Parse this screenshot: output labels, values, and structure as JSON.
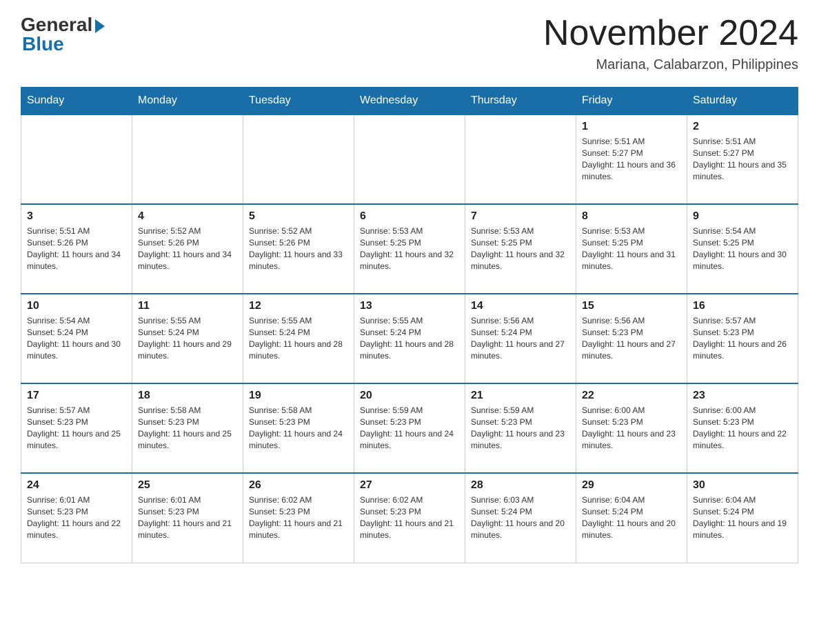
{
  "logo": {
    "general": "General",
    "blue": "Blue"
  },
  "title": "November 2024",
  "location": "Mariana, Calabarzon, Philippines",
  "days_of_week": [
    "Sunday",
    "Monday",
    "Tuesday",
    "Wednesday",
    "Thursday",
    "Friday",
    "Saturday"
  ],
  "weeks": [
    [
      {
        "day": "",
        "sunrise": "",
        "sunset": "",
        "daylight": ""
      },
      {
        "day": "",
        "sunrise": "",
        "sunset": "",
        "daylight": ""
      },
      {
        "day": "",
        "sunrise": "",
        "sunset": "",
        "daylight": ""
      },
      {
        "day": "",
        "sunrise": "",
        "sunset": "",
        "daylight": ""
      },
      {
        "day": "",
        "sunrise": "",
        "sunset": "",
        "daylight": ""
      },
      {
        "day": "1",
        "sunrise": "Sunrise: 5:51 AM",
        "sunset": "Sunset: 5:27 PM",
        "daylight": "Daylight: 11 hours and 36 minutes."
      },
      {
        "day": "2",
        "sunrise": "Sunrise: 5:51 AM",
        "sunset": "Sunset: 5:27 PM",
        "daylight": "Daylight: 11 hours and 35 minutes."
      }
    ],
    [
      {
        "day": "3",
        "sunrise": "Sunrise: 5:51 AM",
        "sunset": "Sunset: 5:26 PM",
        "daylight": "Daylight: 11 hours and 34 minutes."
      },
      {
        "day": "4",
        "sunrise": "Sunrise: 5:52 AM",
        "sunset": "Sunset: 5:26 PM",
        "daylight": "Daylight: 11 hours and 34 minutes."
      },
      {
        "day": "5",
        "sunrise": "Sunrise: 5:52 AM",
        "sunset": "Sunset: 5:26 PM",
        "daylight": "Daylight: 11 hours and 33 minutes."
      },
      {
        "day": "6",
        "sunrise": "Sunrise: 5:53 AM",
        "sunset": "Sunset: 5:25 PM",
        "daylight": "Daylight: 11 hours and 32 minutes."
      },
      {
        "day": "7",
        "sunrise": "Sunrise: 5:53 AM",
        "sunset": "Sunset: 5:25 PM",
        "daylight": "Daylight: 11 hours and 32 minutes."
      },
      {
        "day": "8",
        "sunrise": "Sunrise: 5:53 AM",
        "sunset": "Sunset: 5:25 PM",
        "daylight": "Daylight: 11 hours and 31 minutes."
      },
      {
        "day": "9",
        "sunrise": "Sunrise: 5:54 AM",
        "sunset": "Sunset: 5:25 PM",
        "daylight": "Daylight: 11 hours and 30 minutes."
      }
    ],
    [
      {
        "day": "10",
        "sunrise": "Sunrise: 5:54 AM",
        "sunset": "Sunset: 5:24 PM",
        "daylight": "Daylight: 11 hours and 30 minutes."
      },
      {
        "day": "11",
        "sunrise": "Sunrise: 5:55 AM",
        "sunset": "Sunset: 5:24 PM",
        "daylight": "Daylight: 11 hours and 29 minutes."
      },
      {
        "day": "12",
        "sunrise": "Sunrise: 5:55 AM",
        "sunset": "Sunset: 5:24 PM",
        "daylight": "Daylight: 11 hours and 28 minutes."
      },
      {
        "day": "13",
        "sunrise": "Sunrise: 5:55 AM",
        "sunset": "Sunset: 5:24 PM",
        "daylight": "Daylight: 11 hours and 28 minutes."
      },
      {
        "day": "14",
        "sunrise": "Sunrise: 5:56 AM",
        "sunset": "Sunset: 5:24 PM",
        "daylight": "Daylight: 11 hours and 27 minutes."
      },
      {
        "day": "15",
        "sunrise": "Sunrise: 5:56 AM",
        "sunset": "Sunset: 5:23 PM",
        "daylight": "Daylight: 11 hours and 27 minutes."
      },
      {
        "day": "16",
        "sunrise": "Sunrise: 5:57 AM",
        "sunset": "Sunset: 5:23 PM",
        "daylight": "Daylight: 11 hours and 26 minutes."
      }
    ],
    [
      {
        "day": "17",
        "sunrise": "Sunrise: 5:57 AM",
        "sunset": "Sunset: 5:23 PM",
        "daylight": "Daylight: 11 hours and 25 minutes."
      },
      {
        "day": "18",
        "sunrise": "Sunrise: 5:58 AM",
        "sunset": "Sunset: 5:23 PM",
        "daylight": "Daylight: 11 hours and 25 minutes."
      },
      {
        "day": "19",
        "sunrise": "Sunrise: 5:58 AM",
        "sunset": "Sunset: 5:23 PM",
        "daylight": "Daylight: 11 hours and 24 minutes."
      },
      {
        "day": "20",
        "sunrise": "Sunrise: 5:59 AM",
        "sunset": "Sunset: 5:23 PM",
        "daylight": "Daylight: 11 hours and 24 minutes."
      },
      {
        "day": "21",
        "sunrise": "Sunrise: 5:59 AM",
        "sunset": "Sunset: 5:23 PM",
        "daylight": "Daylight: 11 hours and 23 minutes."
      },
      {
        "day": "22",
        "sunrise": "Sunrise: 6:00 AM",
        "sunset": "Sunset: 5:23 PM",
        "daylight": "Daylight: 11 hours and 23 minutes."
      },
      {
        "day": "23",
        "sunrise": "Sunrise: 6:00 AM",
        "sunset": "Sunset: 5:23 PM",
        "daylight": "Daylight: 11 hours and 22 minutes."
      }
    ],
    [
      {
        "day": "24",
        "sunrise": "Sunrise: 6:01 AM",
        "sunset": "Sunset: 5:23 PM",
        "daylight": "Daylight: 11 hours and 22 minutes."
      },
      {
        "day": "25",
        "sunrise": "Sunrise: 6:01 AM",
        "sunset": "Sunset: 5:23 PM",
        "daylight": "Daylight: 11 hours and 21 minutes."
      },
      {
        "day": "26",
        "sunrise": "Sunrise: 6:02 AM",
        "sunset": "Sunset: 5:23 PM",
        "daylight": "Daylight: 11 hours and 21 minutes."
      },
      {
        "day": "27",
        "sunrise": "Sunrise: 6:02 AM",
        "sunset": "Sunset: 5:23 PM",
        "daylight": "Daylight: 11 hours and 21 minutes."
      },
      {
        "day": "28",
        "sunrise": "Sunrise: 6:03 AM",
        "sunset": "Sunset: 5:24 PM",
        "daylight": "Daylight: 11 hours and 20 minutes."
      },
      {
        "day": "29",
        "sunrise": "Sunrise: 6:04 AM",
        "sunset": "Sunset: 5:24 PM",
        "daylight": "Daylight: 11 hours and 20 minutes."
      },
      {
        "day": "30",
        "sunrise": "Sunrise: 6:04 AM",
        "sunset": "Sunset: 5:24 PM",
        "daylight": "Daylight: 11 hours and 19 minutes."
      }
    ]
  ]
}
